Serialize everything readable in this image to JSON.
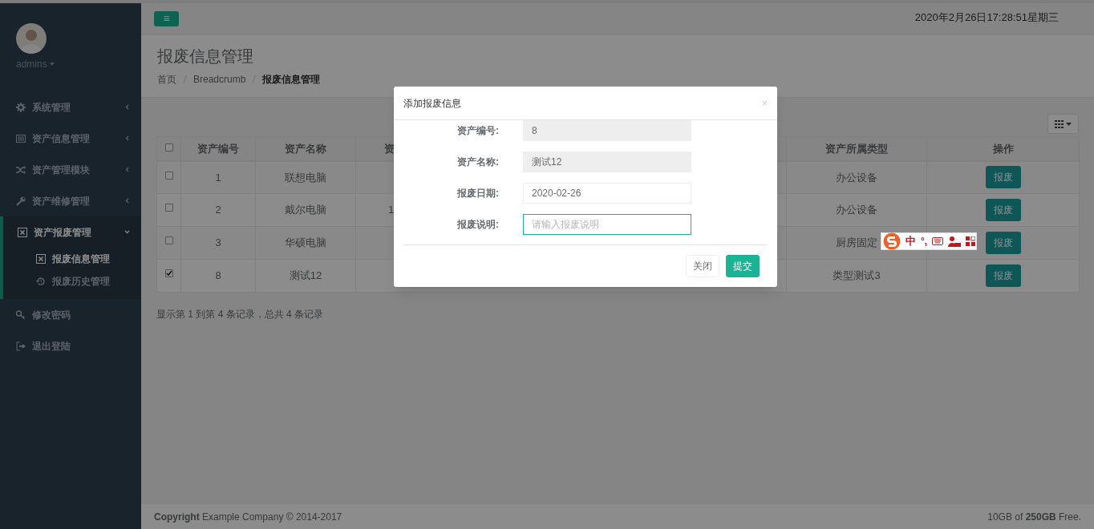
{
  "top_bar": {
    "menu_toggle": "≡",
    "datetime": "2020年2月26日17:28:51星期三"
  },
  "sidebar": {
    "user": {
      "name": "admins"
    },
    "items": [
      {
        "label": "系统管理",
        "kind": "gear",
        "expanded": false,
        "selected": false
      },
      {
        "label": "资产信息管理",
        "kind": "list",
        "expanded": false,
        "selected": false
      },
      {
        "label": "资产管理模块",
        "kind": "shuffle",
        "expanded": false,
        "selected": false
      },
      {
        "label": "资产维修管理",
        "kind": "wrench",
        "expanded": false,
        "selected": false
      },
      {
        "label": "资产报废管理",
        "kind": "xsquare",
        "expanded": true,
        "selected": true,
        "children": [
          {
            "label": "报废信息管理",
            "kind": "xsquare",
            "selected": true
          },
          {
            "label": "报废历史管理",
            "kind": "history",
            "selected": false
          }
        ]
      },
      {
        "label": "修改密码",
        "kind": "key",
        "selected": false
      },
      {
        "label": "退出登陆",
        "kind": "signout",
        "selected": false
      }
    ]
  },
  "page_header": {
    "title": "报废信息管理",
    "breadcrumb": [
      {
        "label": "首页",
        "active": false
      },
      {
        "label": "Breadcrumb",
        "active": false
      },
      {
        "label": "报废信息管理",
        "active": true
      }
    ]
  },
  "table": {
    "columns": [
      "资产编号",
      "资产名称",
      "资",
      "资产所属类型",
      "操作"
    ],
    "rows": [
      {
        "checked": false,
        "asset_no": "1",
        "name": "联想电脑",
        "type": "办公设备",
        "action": "报废"
      },
      {
        "checked": false,
        "asset_no": "2",
        "name": "戴尔电脑",
        "column_4": "1",
        "type": "办公设备",
        "action": "报废"
      },
      {
        "checked": false,
        "asset_no": "3",
        "name": "华硕电脑",
        "type": "厨房固定",
        "action": "报废"
      },
      {
        "checked": true,
        "asset_no": "8",
        "name": "测试12",
        "type": "类型测试3",
        "action": "报废"
      }
    ],
    "header_checked": false,
    "summary": "显示第 1 到第 4 条记录，总共 4 条记录"
  },
  "modal": {
    "title": "添加报废信息",
    "close": "×",
    "fields": [
      {
        "label": "资产编号:",
        "value": "8",
        "readonly": true,
        "focused": false
      },
      {
        "label": "资产名称:",
        "value": "测试12",
        "readonly": true,
        "focused": false
      },
      {
        "label": "报废日期:",
        "value": "2020-02-26",
        "readonly": false,
        "focused": false
      },
      {
        "label": "报废说明:",
        "placeholder": "请输入报废说明",
        "readonly": false,
        "focused": true
      }
    ],
    "buttons": [
      {
        "label": "关闭",
        "kind": "default"
      },
      {
        "label": "提交",
        "kind": "primary"
      }
    ]
  },
  "ime_toolbar": {
    "mode": "中",
    "punctuation": "°,"
  },
  "footer": {
    "copyright": "**Copyright** Example Company © 2014-2017",
    "storage": "10GB of **250GB** Free."
  }
}
